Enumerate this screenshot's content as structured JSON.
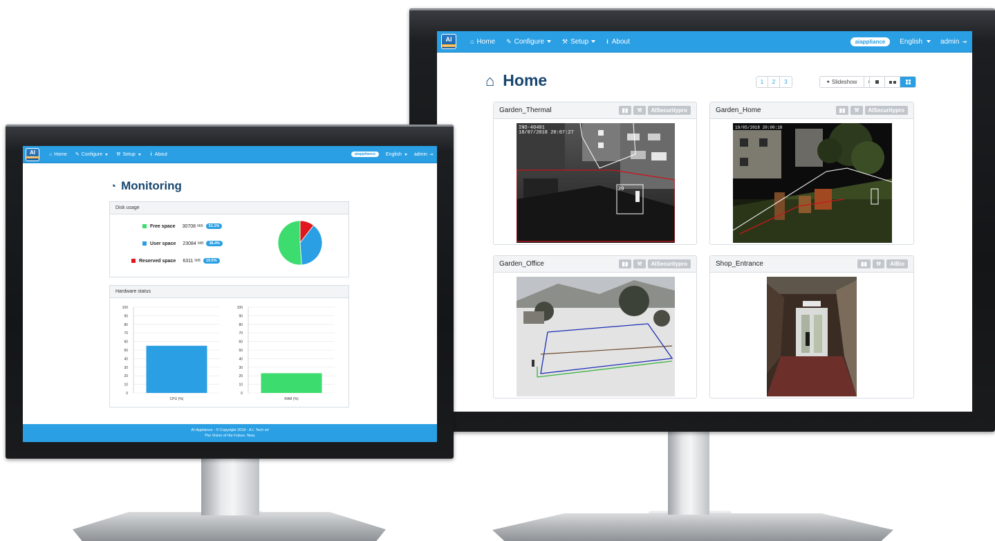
{
  "right_screen": {
    "nav": {
      "logo_text": "AI",
      "logo_sub": "Appliance",
      "home": "Home",
      "configure": "Configure",
      "setup": "Setup",
      "about": "About",
      "device_badge": "aiappliance",
      "language": "English",
      "user": "admin"
    },
    "page_title": "Home",
    "pagination": [
      "1",
      "2",
      "3"
    ],
    "active_page": "1",
    "slideshow_label": "Slideshow",
    "cameras": [
      {
        "name": "Garden_Thermal",
        "app": "AISecuritypro",
        "overlay_text": "INO-40401\n18/07/2018 20:07:27",
        "detection_id": "39"
      },
      {
        "name": "Garden_Home",
        "app": "AISecuritypro",
        "overlay_text": "19/05/2018 20:00:18"
      },
      {
        "name": "Garden_Office",
        "app": "AISecuritypro"
      },
      {
        "name": "Shop_Entrance",
        "app": "AIBio"
      }
    ]
  },
  "left_screen": {
    "nav": {
      "logo_text": "AI",
      "logo_sub": "Appliance",
      "home": "Home",
      "configure": "Configure",
      "setup": "Setup",
      "about": "About",
      "device_badge": "aiappliance",
      "language": "English",
      "user": "admin"
    },
    "page_title": "Monitoring",
    "disk_panel_title": "Disk usage",
    "disk": [
      {
        "label": "Free space",
        "value": "30708",
        "unit": "MiB",
        "percent": "51.1%",
        "color": "#3ddc6f"
      },
      {
        "label": "User space",
        "value": "23084",
        "unit": "MiB",
        "percent": "38.4%",
        "color": "#2a9fe3"
      },
      {
        "label": "Reserved space",
        "value": "6311",
        "unit": "MiB",
        "percent": "10.5%",
        "color": "#e0181d"
      }
    ],
    "hardware_panel_title": "Hardware status",
    "footer_line1": "AI-Appliance - © Copyright 2018 - A.I. Tech srl",
    "footer_line2": "The Vision of the Future. Now."
  },
  "chart_data": [
    {
      "type": "pie",
      "title": "Disk usage",
      "categories": [
        "Free space",
        "User space",
        "Reserved space"
      ],
      "values": [
        51.1,
        38.4,
        10.5
      ],
      "colors": [
        "#3ddc6f",
        "#2a9fe3",
        "#e0181d"
      ]
    },
    {
      "type": "bar",
      "categories": [
        "CPU (%)"
      ],
      "values": [
        55
      ],
      "ylim": [
        0,
        100
      ],
      "yticks": [
        0,
        10,
        20,
        30,
        40,
        50,
        60,
        70,
        80,
        90,
        100
      ],
      "color": "#2a9fe3",
      "grid": true
    },
    {
      "type": "bar",
      "categories": [
        "RAM (%)"
      ],
      "values": [
        23
      ],
      "ylim": [
        0,
        100
      ],
      "yticks": [
        0,
        10,
        20,
        30,
        40,
        50,
        60,
        70,
        80,
        90,
        100
      ],
      "color": "#3ddc6f",
      "grid": true
    }
  ]
}
